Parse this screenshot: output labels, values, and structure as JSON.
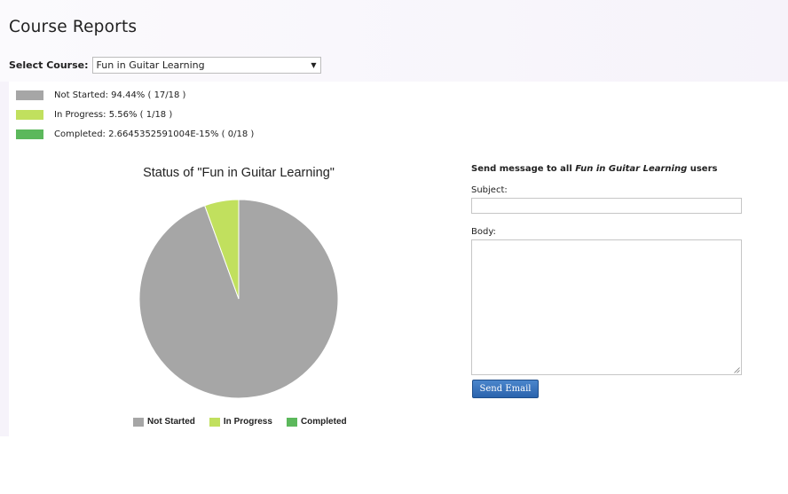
{
  "page": {
    "title": "Course Reports"
  },
  "course_select": {
    "label": "Select Course:",
    "value": "Fun in Guitar Learning",
    "arrow": "▼"
  },
  "stats": [
    {
      "text": "Not Started: 94.44% ( 17/18 )",
      "color": "#a6a6a6"
    },
    {
      "text": "In Progress: 5.56% ( 1/18 )",
      "color": "#c1e05e"
    },
    {
      "text": "Completed: 2.6645352591004E-15% ( 0/18 )",
      "color": "#5cb85c"
    }
  ],
  "chart_data": {
    "type": "pie",
    "title": "Status of \"Fun in Guitar Learning\"",
    "labels": [
      "Not Started",
      "In Progress",
      "Completed"
    ],
    "values": [
      17,
      1,
      0
    ],
    "colors": [
      "#a6a6a6",
      "#c1e05e",
      "#5cb85c"
    ],
    "legend": "bottom"
  },
  "message": {
    "heading_prefix": "Send message to all ",
    "heading_course": "Fun in Guitar Learning",
    "heading_suffix": " users",
    "subject_label": "Subject:",
    "subject_value": "",
    "body_label": "Body:",
    "body_value": "",
    "send_label": "Send Email"
  }
}
